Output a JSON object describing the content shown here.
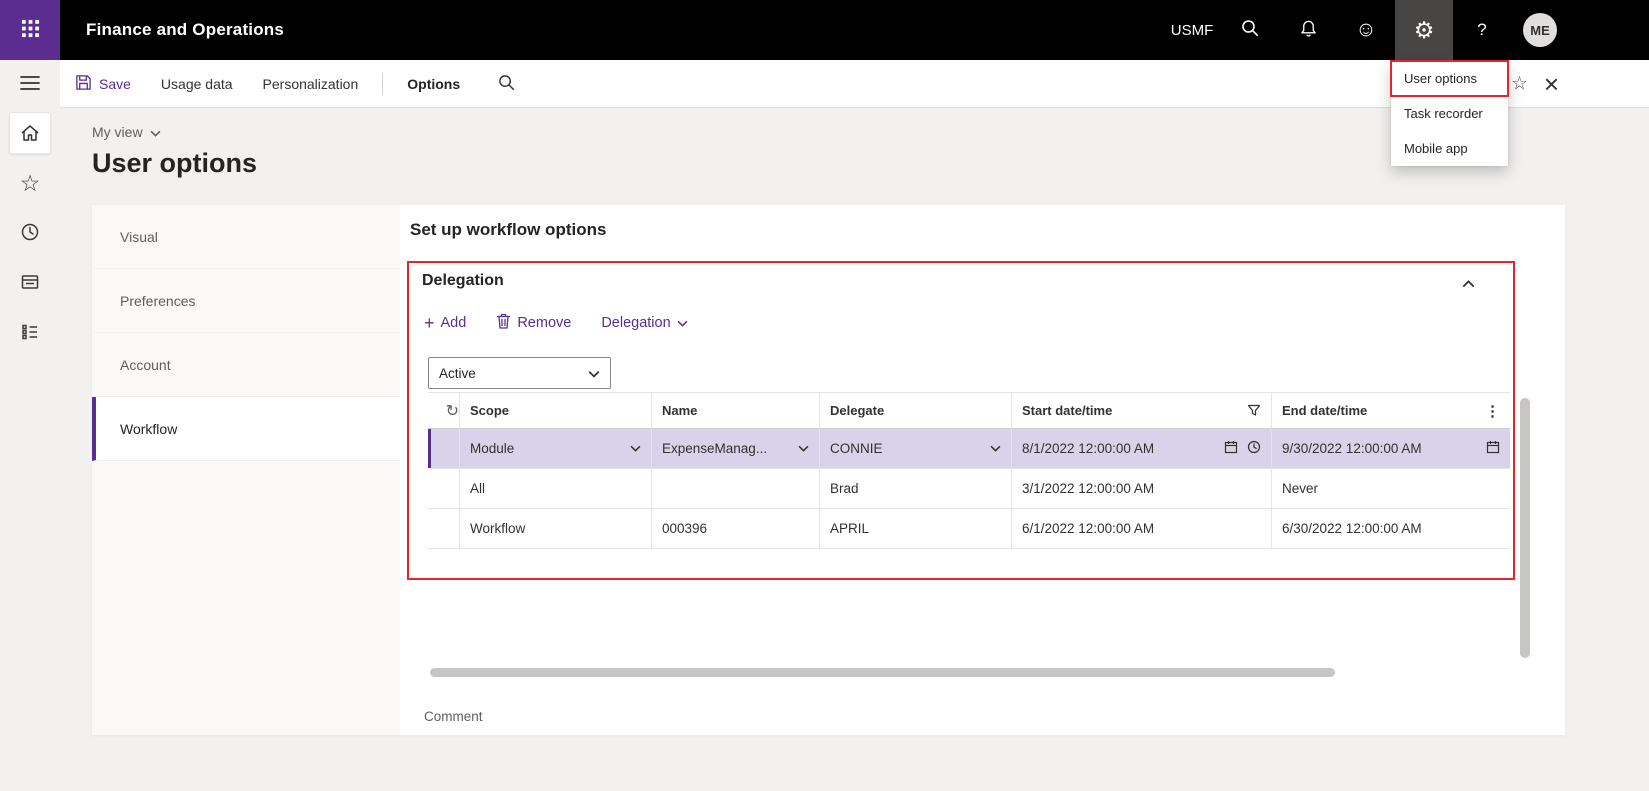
{
  "colors": {
    "accent": "#5c2d91",
    "topbar-bg": "#000000",
    "gear-highlight": "#484644",
    "annotation": "#e8232e",
    "selected-row": "#d8d2ea"
  },
  "icons": {
    "gear": "⚙",
    "smiley": "☺",
    "help": "?",
    "close": "×",
    "star": "☆",
    "more": "⋮",
    "refresh": "↻",
    "add": "+"
  },
  "topbar": {
    "app_title": "Finance and Operations",
    "company": "USMF",
    "avatar_initials": "ME"
  },
  "action_bar": {
    "save": "Save",
    "usage_data": "Usage data",
    "personalization": "Personalization",
    "options": "Options"
  },
  "settings_menu": {
    "items": [
      {
        "label": "User options"
      },
      {
        "label": "Task recorder"
      },
      {
        "label": "Mobile app"
      }
    ]
  },
  "page": {
    "view_selector": "My view",
    "title": "User options",
    "tabs": [
      {
        "label": "Visual"
      },
      {
        "label": "Preferences"
      },
      {
        "label": "Account"
      },
      {
        "label": "Workflow"
      }
    ],
    "content": {
      "heading": "Set up workflow options",
      "comment_label": "Comment",
      "section": {
        "title": "Delegation",
        "toolbar": {
          "add": "Add",
          "remove": "Remove",
          "menu": "Delegation"
        },
        "status_filter": "Active",
        "grid": {
          "columns": [
            "Scope",
            "Name",
            "Delegate",
            "Start date/time",
            "End date/time"
          ],
          "rows": [
            {
              "scope": "Module",
              "name": "ExpenseManag...",
              "delegate": "CONNIE",
              "start": "8/1/2022 12:00:00 AM",
              "end": "9/30/2022 12:00:00 AM"
            },
            {
              "scope": "All",
              "name": "",
              "delegate": "Brad",
              "start": "3/1/2022 12:00:00 AM",
              "end": "Never"
            },
            {
              "scope": "Workflow",
              "name": "000396",
              "delegate": "APRIL",
              "start": "6/1/2022 12:00:00 AM",
              "end": "6/30/2022 12:00:00 AM"
            }
          ]
        }
      }
    }
  }
}
